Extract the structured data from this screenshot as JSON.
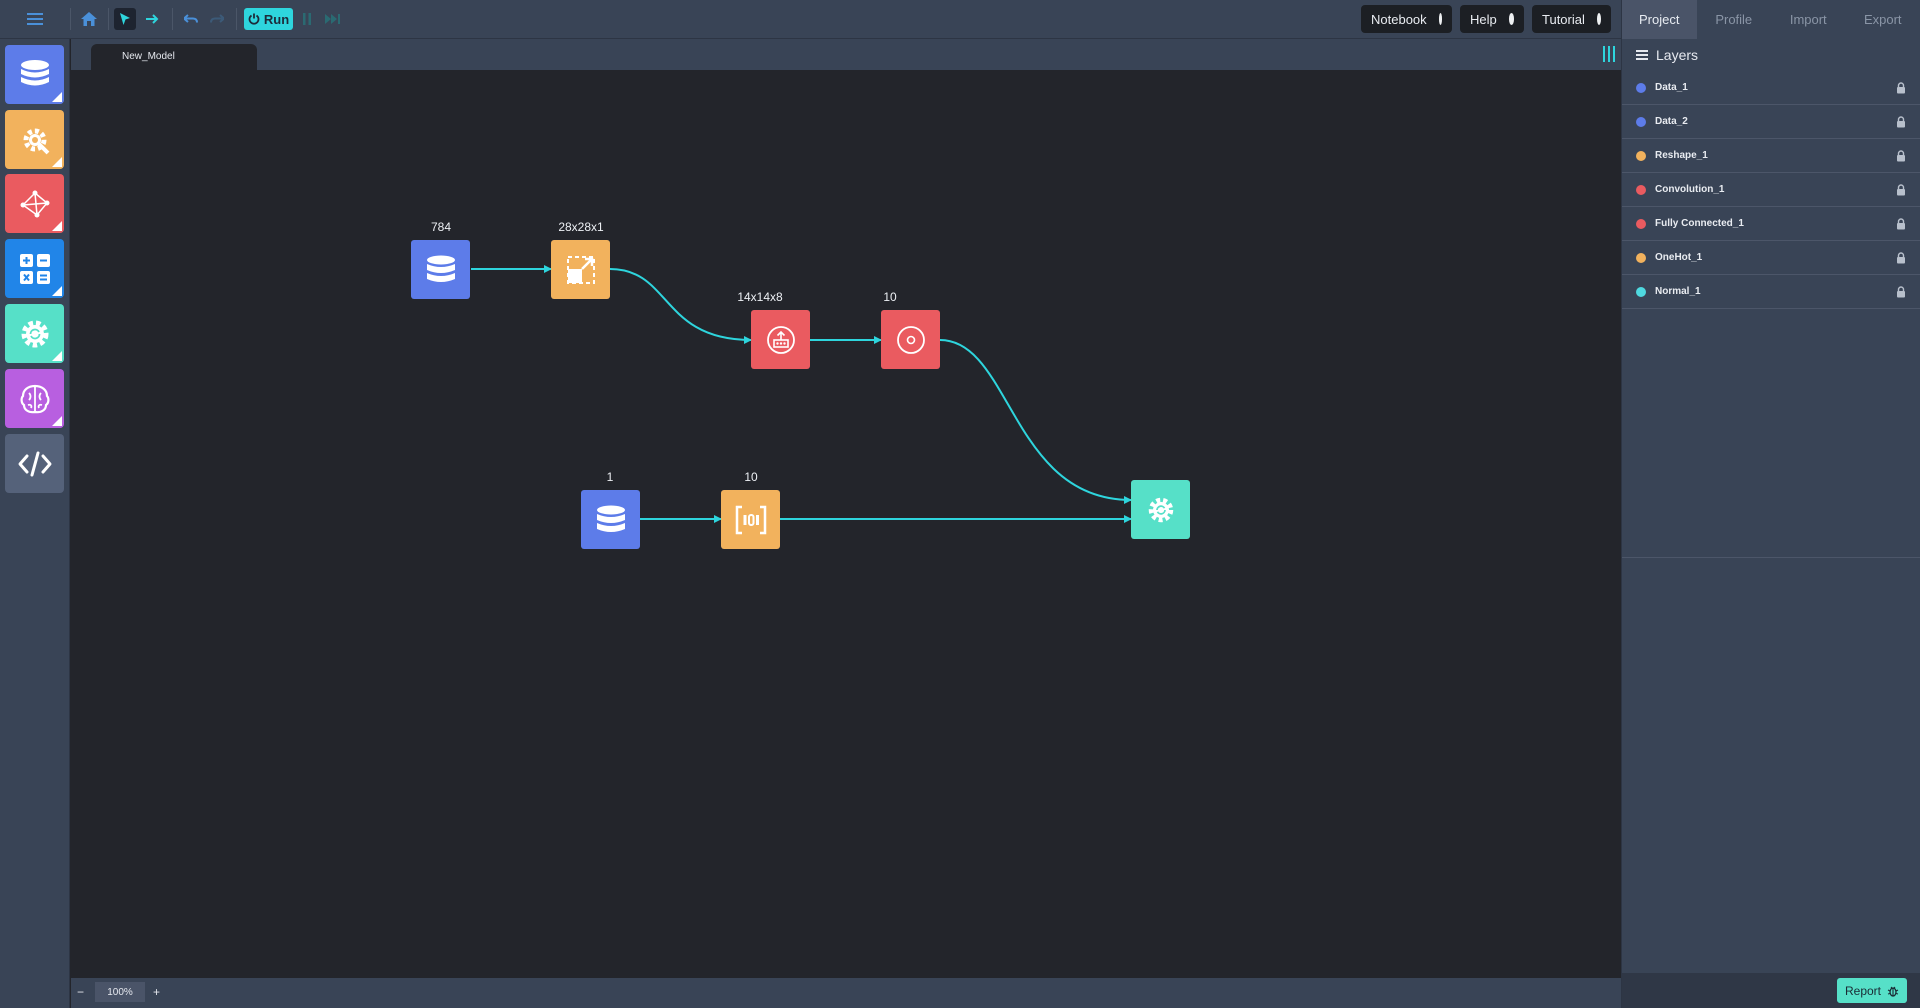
{
  "toolbar": {
    "run_label": "Run",
    "notebook_label": "Notebook",
    "help_label": "Help",
    "tutorial_label": "Tutorial"
  },
  "right_panel": {
    "tabs": [
      "Project",
      "Profile",
      "Import",
      "Export"
    ],
    "active_tab": "Project",
    "layers_title": "Layers",
    "layers": [
      {
        "name": "Data_1",
        "color": "#5d7ce9"
      },
      {
        "name": "Data_2",
        "color": "#5d7ce9"
      },
      {
        "name": "Reshape_1",
        "color": "#f2b25d"
      },
      {
        "name": "Convolution_1",
        "color": "#ea5b60"
      },
      {
        "name": "Fully Connected_1",
        "color": "#ea5b60"
      },
      {
        "name": "OneHot_1",
        "color": "#f2b25d"
      },
      {
        "name": "Normal_1",
        "color": "#4fd9e0"
      }
    ],
    "report_label": "Report"
  },
  "sidebar": {
    "tools": [
      {
        "name": "data-tool",
        "icon": "database-icon",
        "color": "#5d7ce9"
      },
      {
        "name": "processing-tool",
        "icon": "gear-wrench-icon",
        "color": "#f2b25d"
      },
      {
        "name": "deep-learning-tool",
        "icon": "network-icon",
        "color": "#ea5b60"
      },
      {
        "name": "math-tool",
        "icon": "calculator-icon",
        "color": "#2185e8"
      },
      {
        "name": "training-tool",
        "icon": "gear-refresh-icon",
        "color": "#56e0c8"
      },
      {
        "name": "ai-tool",
        "icon": "brain-icon",
        "color": "#b85fe0"
      },
      {
        "name": "code-tool",
        "icon": "code-icon",
        "color": "#55627a"
      }
    ]
  },
  "canvas": {
    "model_tab_label": "New_Model",
    "zoom_label": "100%",
    "zoom_minus": "−",
    "zoom_plus": "+",
    "nodes": [
      {
        "id": "data1",
        "label": "784",
        "type": "database-icon",
        "color": "#5d7ce9"
      },
      {
        "id": "reshape",
        "label": "28x28x1",
        "type": "reshape-icon",
        "color": "#f2b25d"
      },
      {
        "id": "conv",
        "label": "14x14x8",
        "type": "convolution-icon",
        "color": "#ea5b60"
      },
      {
        "id": "fc",
        "label": "10",
        "type": "fully-connected-icon",
        "color": "#ea5b60"
      },
      {
        "id": "data2",
        "label": "1",
        "type": "database-icon",
        "color": "#5d7ce9"
      },
      {
        "id": "onehot",
        "label": "10",
        "type": "onehot-icon",
        "color": "#f2b25d"
      },
      {
        "id": "train",
        "label": "",
        "type": "gear-refresh-icon",
        "color": "#56e0c8"
      }
    ],
    "wire_color": "#2ed5dd"
  }
}
